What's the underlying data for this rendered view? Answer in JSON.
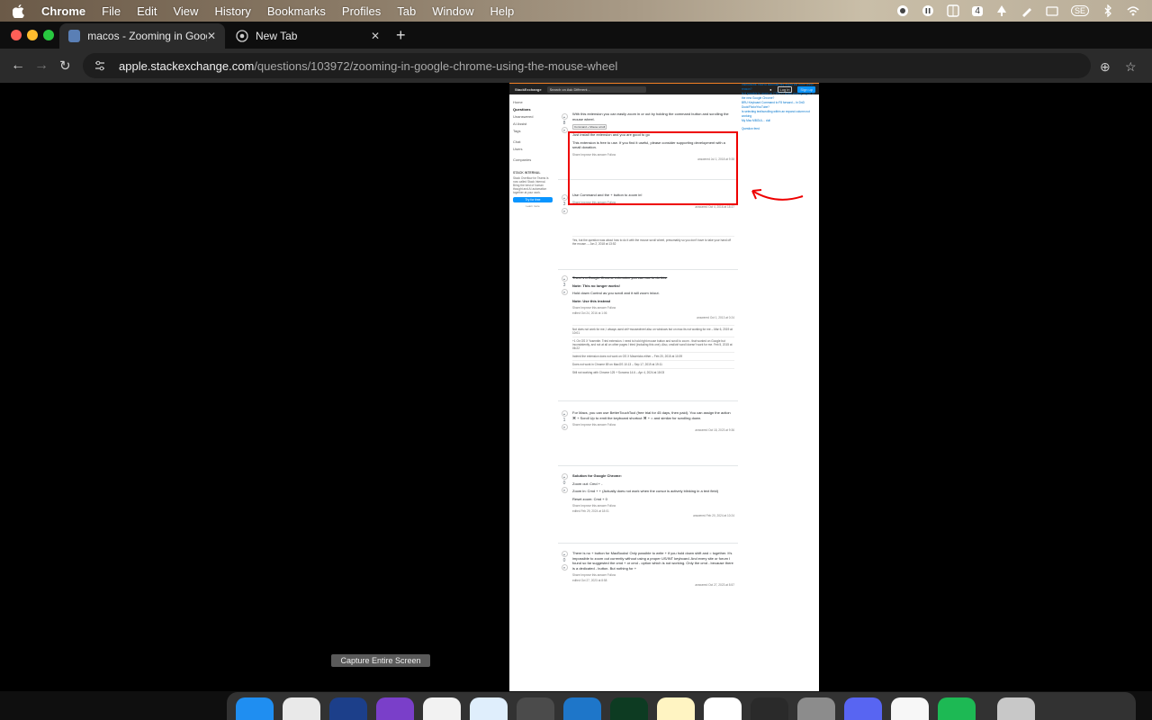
{
  "menubar": {
    "app": "Chrome",
    "items": [
      "File",
      "Edit",
      "View",
      "History",
      "Bookmarks",
      "Profiles",
      "Tab",
      "Window",
      "Help"
    ],
    "status_badge": "4",
    "status_se": "SE"
  },
  "tabs": [
    {
      "title": "macos - Zooming in Google C",
      "active": true
    },
    {
      "title": "New Tab",
      "active": false
    }
  ],
  "omnibox": {
    "host": "apple.stackexchange.com",
    "path": "/questions/103972/zooming-in-google-chrome-using-the-mouse-wheel"
  },
  "se": {
    "logo": "StackExchange",
    "search_placeholder": "Search on Ask Different...",
    "login": "Log in",
    "signup": "Sign up",
    "nav": [
      "Home",
      "Questions",
      "Unanswered",
      "AI Assist",
      "Tags",
      "Chat",
      "Users",
      "Companies"
    ],
    "teams_title": "STACK INTERNAL",
    "teams_text": "Stack Overflow for Teams is now called Stack Internal. Bring the best of human thought and AI automation together at your work.",
    "teams_btn": "Try for free",
    "teams_link": "Learn more",
    "a1": {
      "p1": "With this extension you can easily zoom in or out by holding the command button and scrolling the mouse wheel.",
      "keys": "Command + Mouse scroll",
      "p2": "Just install the extension and you are good to go",
      "p3": "This extension is free to use. If you find it useful, please consider supporting development with a small donation.",
      "votes": "8",
      "links": "Share  Improve this answer  Follow",
      "answered": "answered Jul 1, 2018 at 9:38"
    },
    "a2": {
      "p1": "Use Command and the + button to zoom in!",
      "votes": "3",
      "links": "Share  Improve this answer  Follow",
      "answered": "answered Oct 4, 2016 at 18:37",
      "comment": "Yes, but the question was about how to do it with the mouse scroll wheel, presumably so you don't have to take your hand off the mouse. – Jun 2, 2018 at 13:52"
    },
    "a3": {
      "strike": "There's a Google Chrome extension you can use to do this.",
      "note1": "Note: This no longer works!",
      "p1": "Hold down Control as you scroll and it will zoom in/out.",
      "note2": "Note: Use this instead",
      "votes": "3",
      "links": "Share  Improve this answer  Follow",
      "edited": "edited Oct 24, 2016 at 1:06",
      "answered": "answered Oct 1, 2013 at 0:24",
      "comments": [
        "Not does not work for me, I always used ctrl+mousewheel also on windows but on mac its not working for me – Mar 6, 2019 at 10:01",
        "+1 On OS X Yosemite. Tried extension. I need to hold right mouse button and scroll to zoom - that worked on Google but inconsistently, and not at all on other pages I tried (including this one). Also, cmd/ctrl scroll doesn't work for me. Feb 5, 2015 at 06:22",
        "Indeed the extension does not work on OS X Mavericks either – Feb 20, 2015 at 10:39",
        "Does not work in Chrome 89 on MacOS 10.13 – Sep 17, 2019 at 19:11",
        "Still not working with Chrome 125 + Sonoma 14.6 – Apr 4, 2024 at 18:03"
      ]
    },
    "a4": {
      "p1": "For Macs, you can use BetterTouchTool (free trial for 45 days, then paid). You can assign the action ⌘ + Scroll Up to emit the keyboard shortcut ⌘ + = and similar for scrolling down.",
      "votes": "1",
      "links": "Share  Improve this answer  Follow",
      "answered": "answered Oct 18, 2023 at 9:36"
    },
    "a5": {
      "title": "Solution for Google Chrome:",
      "items": [
        "Zoom out: Cmd + -",
        "Zoom in: Cmd + + (Actually does not work when the cursor is actively blinking in a text field)",
        "Reset zoom: Cmd + 0"
      ],
      "votes": "0",
      "links": "Share  Improve this answer  Follow",
      "edited": "edited Feb 29, 2024 at 18:01",
      "answered": "answered Feb 20, 2024 at 10:24"
    },
    "a6": {
      "p1": "There is no + button for MacBooks! Only possible to write + if you hold down shift and = together. It's impossible to zoom out currently without using a proper US/INT keyboard. And every site or forum I found so far suggested the cmd + or cmd - option which is not working. Only the cmd - because there is a dedicated - button. But nothing for +",
      "votes": "0",
      "links": "Share  Improve this answer  Follow",
      "edited": "edited Oct 27, 2023 at 8:58",
      "answered": "answered Oct 27, 2023 at 8:57"
    },
    "sidebar_links": [
      "Instructions: How to automatically adjust the zoom within reason?",
      "Is it possible to zoom on CTRL+? to the viewing region of the new Google Chrome?",
      "BRU Keyboard Command to F8 forward – In DnD Duck/Flickr/YouTube?",
      "Is selecting text/scrolling within an expand column not working",
      "My Mac MBOUL... dull"
    ],
    "question_feed": "Question feed"
  },
  "capture_tip": "Capture Entire Screen",
  "colors": {
    "annotation": "#e00000",
    "se_accent": "#f48024",
    "se_blue": "#0a95ff"
  }
}
